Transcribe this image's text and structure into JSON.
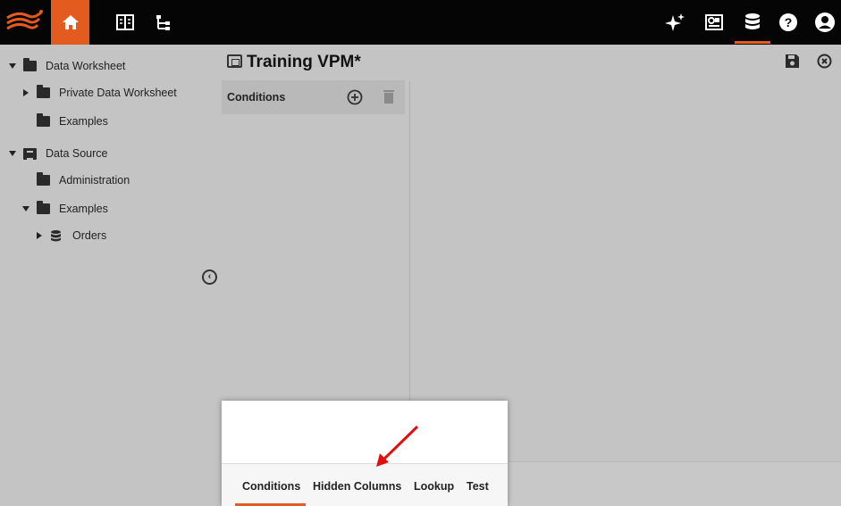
{
  "topbar": {
    "logo_icon": "denodo-logo-icon",
    "home_icon": "home-icon",
    "book_icon": "book-icon",
    "tree_icon": "tree-icon",
    "ai_icon": "sparkle-icon",
    "monitor_icon": "monitor-icon",
    "database_icon": "database-icon",
    "help_icon": "help-icon",
    "user_icon": "user-icon",
    "accent_color": "#e35b1e"
  },
  "sidebar": {
    "items": [
      {
        "label": "Data Worksheet",
        "expanded": true,
        "icon": "folder-icon"
      },
      {
        "label": "Private Data Worksheet",
        "expanded": false,
        "icon": "folder-icon"
      },
      {
        "label": "Examples",
        "icon": "folder-icon"
      },
      {
        "label": "Data Source",
        "expanded": true,
        "icon": "datasource-icon"
      },
      {
        "label": "Administration",
        "icon": "folder-icon"
      },
      {
        "label": "Examples",
        "expanded": true,
        "icon": "folder-icon"
      },
      {
        "label": "Orders",
        "expanded": false,
        "icon": "database-icon"
      }
    ],
    "collapse_glyph": "‹"
  },
  "main": {
    "title": "Training VPM*",
    "conditions_panel": {
      "title": "Conditions"
    }
  },
  "popup": {
    "tabs": [
      {
        "label": "Conditions",
        "active": true
      },
      {
        "label": "Hidden Columns",
        "active": false
      },
      {
        "label": "Lookup",
        "active": false
      },
      {
        "label": "Test",
        "active": false
      }
    ]
  }
}
